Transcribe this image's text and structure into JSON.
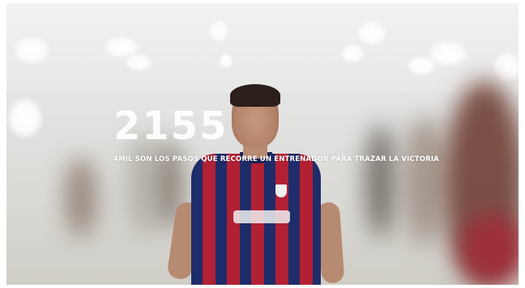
{
  "overlay": {
    "number": "2155",
    "caption": "4MIL SON LOS PASOS QUE RECORRE UN ENTRENADOR PARA TRAZAR LA VICTORIA"
  },
  "colors": {
    "shirt_red": "#b22033",
    "shirt_blue": "#1f2c6a",
    "overlay_text": "#ffffff"
  }
}
